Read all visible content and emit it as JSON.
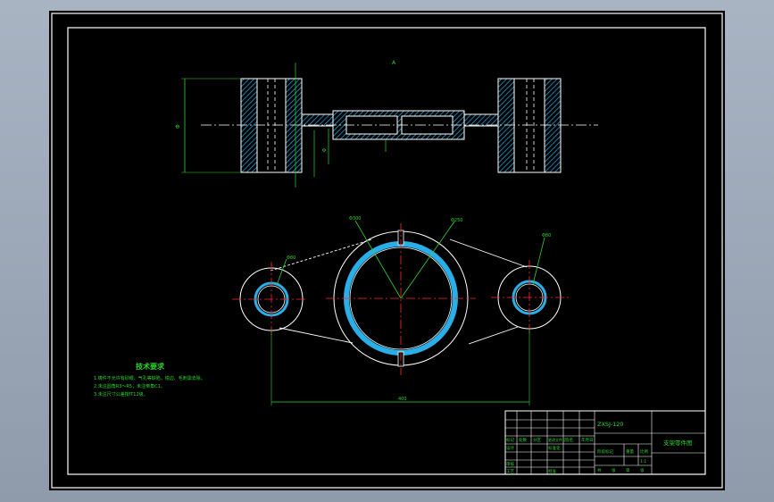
{
  "drawing": {
    "top_view_label": "A",
    "dim_height": "Φ",
    "dim_shaft": "Φ",
    "dim_center_distance": "400",
    "leader_left_hole": "Φ80",
    "leader_center_outer": "Φ300",
    "leader_center_inner": "Φ250",
    "leader_right_hole": "Φ80"
  },
  "notes": {
    "title": "技术要求",
    "lines": [
      "1.铸件不允许有砂眼、气孔等缺陷，锐边、毛刺需去除。",
      "2.未注圆角R3～R5，未注倒角C1。",
      "3.未注尺寸公差按IT12级。"
    ]
  },
  "title_block": {
    "part_number": "ZXSJ-120",
    "part_name": "支架零件图",
    "row_labels": [
      "标记",
      "处数",
      "分区",
      "更改文件号",
      "签名",
      "年月日"
    ],
    "left_labels": [
      "设计",
      "审核",
      "工艺"
    ],
    "stage_label": "阶段标记",
    "weight_label": "重量",
    "scale_label": "比例",
    "scale_value": "1:1",
    "sheet_labels": [
      "共",
      "张",
      "第",
      "张"
    ],
    "approve_label": "批准",
    "std_label": "标准化"
  }
}
